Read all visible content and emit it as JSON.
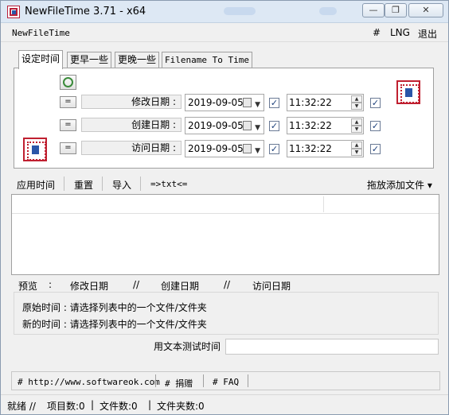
{
  "window": {
    "title": "NewFileTime 3.71 - x64",
    "minimize_glyph": "—",
    "maximize_glyph": "❐",
    "close_glyph": "✕"
  },
  "menubar": {
    "app_name": "NewFileTime",
    "hash": "#",
    "lng": "LNG",
    "exit": "退出"
  },
  "tabs": [
    {
      "label": "设定时间",
      "active": true
    },
    {
      "label": "更早一些",
      "active": false
    },
    {
      "label": "更晚一些",
      "active": false
    },
    {
      "label": "Filename To Time",
      "active": false
    }
  ],
  "time_rows": [
    {
      "eq_label": "=",
      "label": "修改日期 :",
      "date": "2019-09-05",
      "date_checked": true,
      "time": "11:32:22",
      "time_checked": true
    },
    {
      "eq_label": "=",
      "label": "创建日期 :",
      "date": "2019-09-05",
      "date_checked": true,
      "time": "11:32:22",
      "time_checked": true
    },
    {
      "eq_label": "=",
      "label": "访问日期 :",
      "date": "2019-09-05",
      "date_checked": true,
      "time": "11:32:22",
      "time_checked": true
    }
  ],
  "toolbar": {
    "apply": "应用时间",
    "reset": "重置",
    "import": "导入",
    "txt": "=>txt<=",
    "drag_add": "拖放添加文件 ▾"
  },
  "preview": {
    "label": "预览",
    "colon": ":",
    "modified": "修改日期",
    "sep1": "//",
    "created": "创建日期",
    "sep2": "//",
    "accessed": "访问日期"
  },
  "info": {
    "original": "原始时间 :  请选择列表中的一个文件/文件夹",
    "new": "新的时间 :  请选择列表中的一个文件/文件夹"
  },
  "text_test": {
    "label": "用文本测试时间",
    "value": ""
  },
  "footer": {
    "url": "# http://www.softwareok.com",
    "donate": "# 捐赠",
    "faq": "# FAQ"
  },
  "status": {
    "ready": "就绪 //",
    "items": "项目数:0",
    "files": "文件数:0",
    "folders": "文件夹数:0",
    "sep": "|"
  },
  "colors": {
    "titlebar": "#dde8f4",
    "window_bg": "#f0f0f0",
    "icon_red": "#c02030",
    "icon_blue": "#2a56a8"
  }
}
